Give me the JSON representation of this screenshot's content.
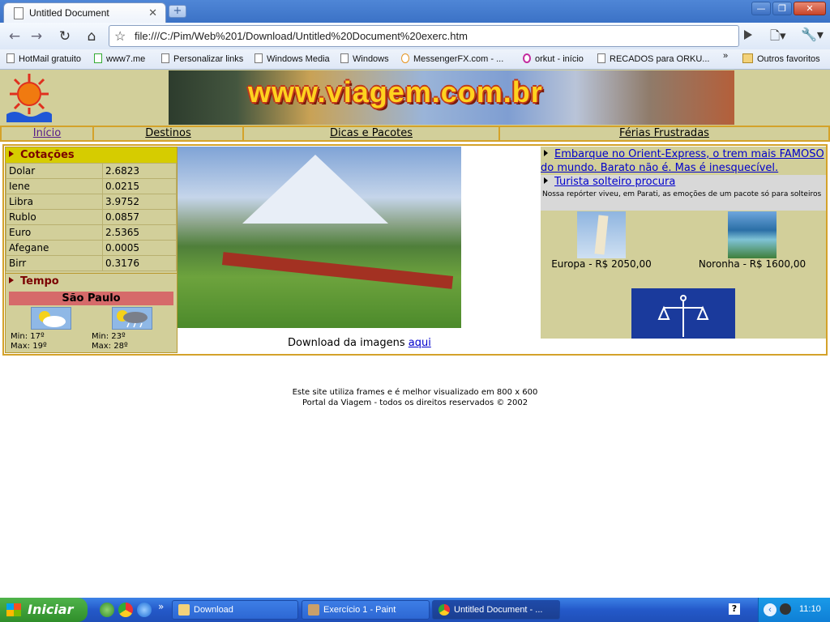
{
  "browser": {
    "tab_title": "Untitled Document",
    "tab_close": "✕",
    "new_tab": "+",
    "url": "file:///C:/Pim/Web%201/Download/Untitled%20Document%20exerc.htm",
    "window_controls": {
      "minimize": "—",
      "maximize": "❐",
      "close": "✕"
    },
    "bookmarks": [
      "HotMail gratuito",
      "www7.me",
      "Personalizar links",
      "Windows Media",
      "Windows",
      "MessengerFX.com - ...",
      "orkut - início",
      "RECADOS para ORKU...",
      "Outros favoritos"
    ],
    "bookmarks_overflow": "»"
  },
  "site": {
    "banner_text": "www.viagem.com.br",
    "menu": [
      "Início",
      "Destinos",
      "Dicas e Pacotes",
      "Férias Frustradas"
    ],
    "cotacoes": {
      "title": "Cotações",
      "rows": [
        {
          "name": "Dolar",
          "value": "2.6823"
        },
        {
          "name": "Iene",
          "value": "0.0215"
        },
        {
          "name": "Libra",
          "value": "3.9752"
        },
        {
          "name": "Rublo",
          "value": "0.0857"
        },
        {
          "name": "Euro",
          "value": "2.5365"
        },
        {
          "name": "Afegane",
          "value": "0.0005"
        },
        {
          "name": "Birr",
          "value": "0.3176"
        }
      ]
    },
    "tempo": {
      "title": "Tempo",
      "city": "São Paulo",
      "days": [
        {
          "min": "Min: 17º",
          "max": "Max: 19º"
        },
        {
          "min": "Min: 23º",
          "max": "Max: 28º"
        }
      ]
    },
    "download": {
      "text": "Download da imagens",
      "link": "aqui"
    },
    "news": [
      {
        "title": "Embarque no Orient-Express, o trem mais FAMOSO do mundo. Barato não é. Mas é inesquecível."
      },
      {
        "title": "Turista solteiro procura"
      }
    ],
    "news_desc": "Nossa repórter viveu, em Parati, as emoções de um pacote só para solteiros",
    "destinations": [
      {
        "label": "Europa - R$ 2050,00"
      },
      {
        "label": "Noronha - R$ 1600,00"
      }
    ],
    "footer": [
      "Este site utiliza frames e é melhor visualizado em 800 x 600",
      "Portal da Viagem - todos os direitos reservados © 2002"
    ]
  },
  "taskbar": {
    "start": "Iniciar",
    "tasks": [
      "Download",
      "Exercício 1 - Paint",
      "Untitled Document - ..."
    ],
    "overflow": "»",
    "clock": "11:10",
    "help": "?"
  }
}
